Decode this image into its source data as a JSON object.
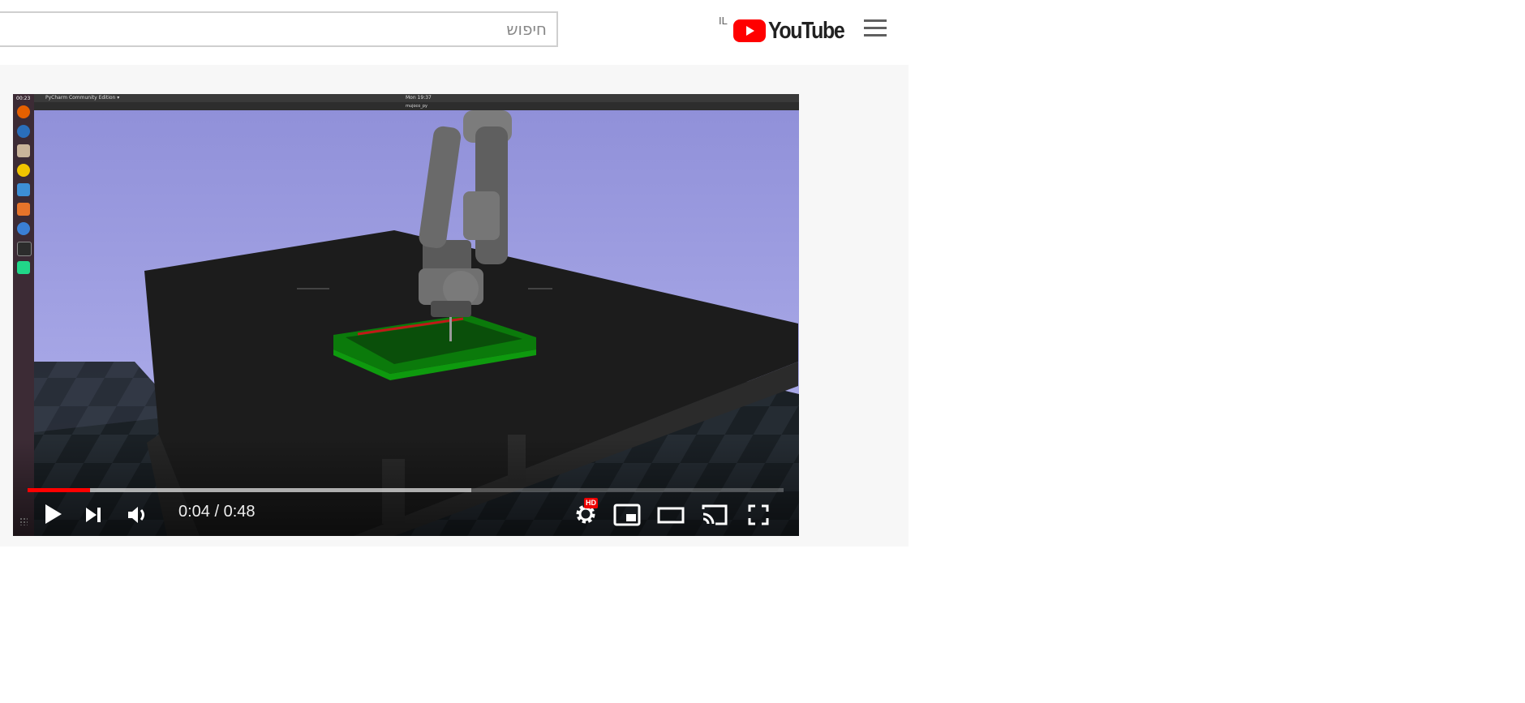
{
  "masthead": {
    "search": {
      "placeholder": "חיפוש",
      "value": ""
    },
    "logo_text": "YouTube",
    "country_code": "IL"
  },
  "player": {
    "desktop": {
      "app_label": "PyCharm Community Edition ▾",
      "clock": "Mon 19:37",
      "window_title": "mujoco_py",
      "dock_time": "00:23"
    },
    "progress": {
      "played_fraction": 0.083,
      "loaded_fraction": 0.587
    },
    "time": {
      "current": "0:04",
      "separator": " / ",
      "duration": "0:48"
    },
    "settings_badge": "HD"
  },
  "colors": {
    "brand_red": "#ff0000",
    "sky": "#a0a0e6",
    "tray_green": "#0b6e0b"
  }
}
